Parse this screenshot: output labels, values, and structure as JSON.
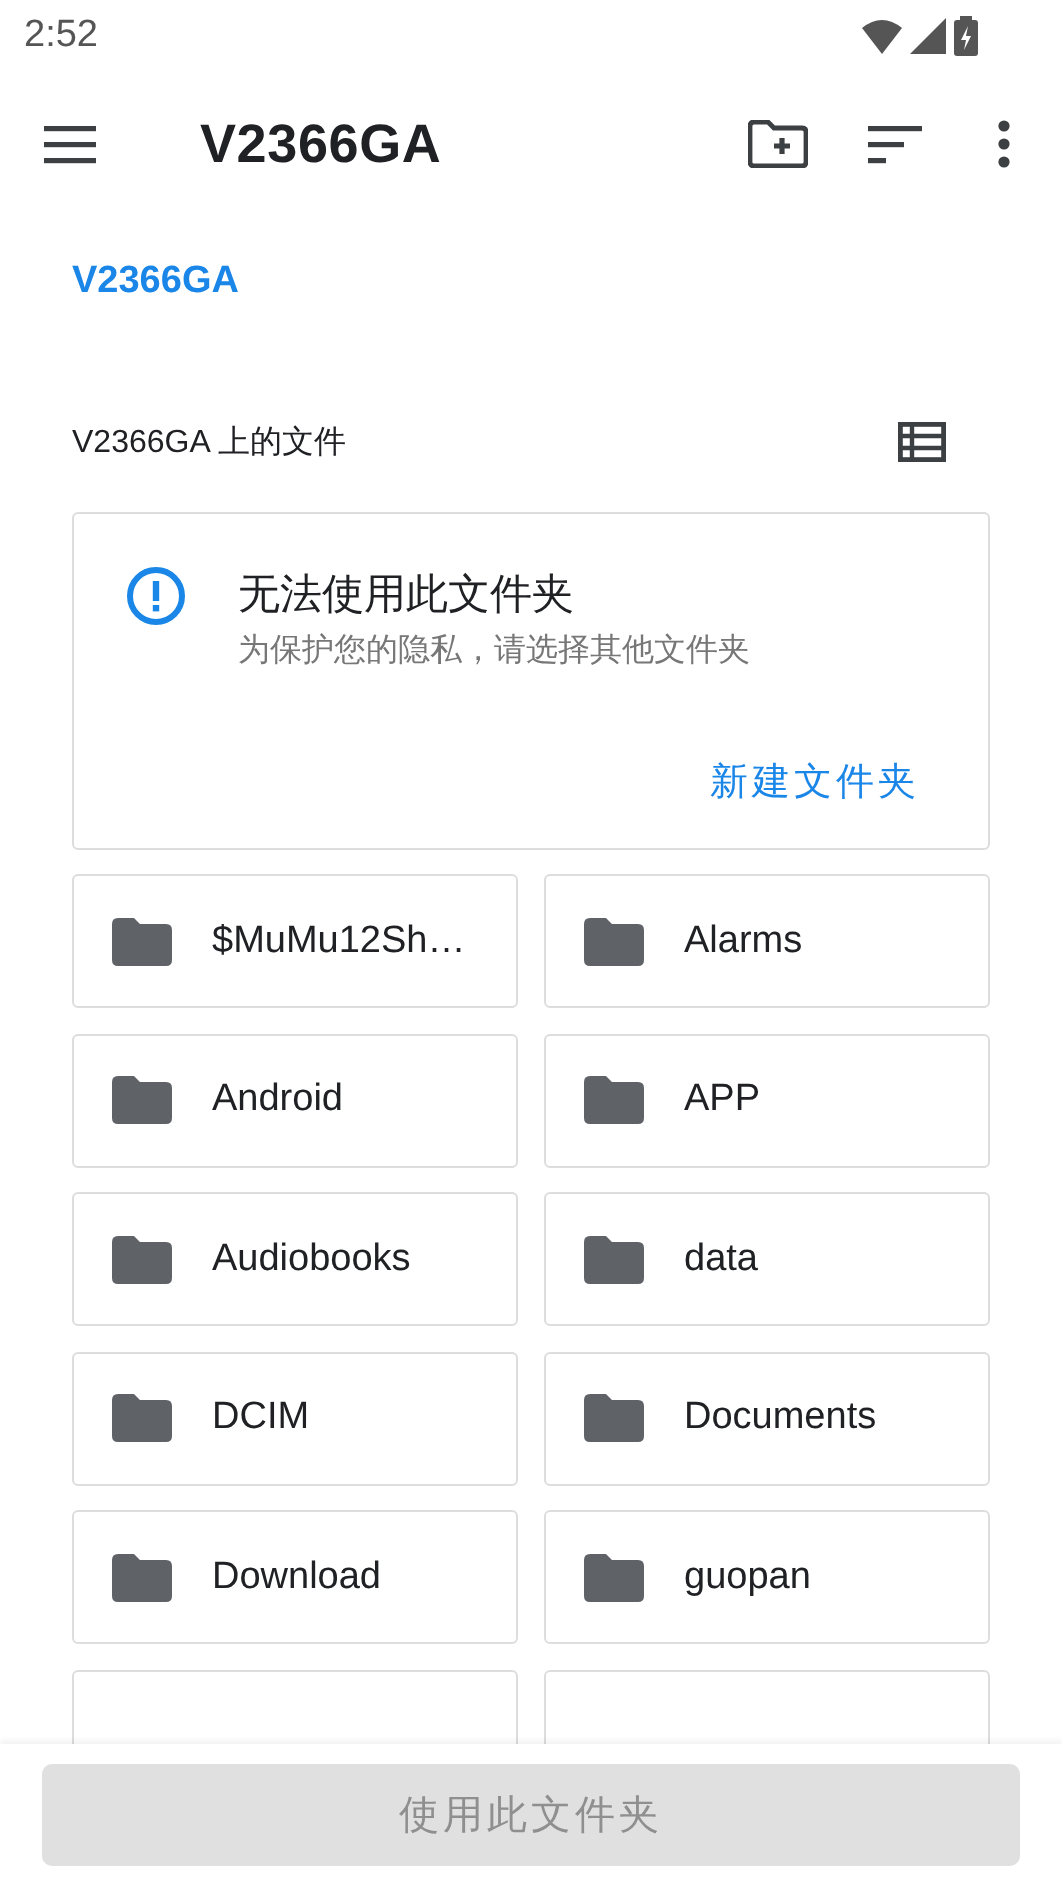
{
  "status_bar": {
    "time": "2:52"
  },
  "toolbar": {
    "title": "V2366GA"
  },
  "breadcrumb": "V2366GA",
  "section": {
    "title": "V2366GA 上的文件"
  },
  "notice": {
    "title": "无法使用此文件夹",
    "message": "为保护您的隐私，请选择其他文件夹",
    "action": "新建文件夹"
  },
  "folders": [
    {
      "name": "$MuMu12Sh…"
    },
    {
      "name": "Alarms"
    },
    {
      "name": "Android"
    },
    {
      "name": "APP"
    },
    {
      "name": "Audiobooks"
    },
    {
      "name": "data"
    },
    {
      "name": "DCIM"
    },
    {
      "name": "Documents"
    },
    {
      "name": "Download"
    },
    {
      "name": "guopan"
    }
  ],
  "bottom_button": {
    "label": "使用此文件夹",
    "disabled": true
  }
}
